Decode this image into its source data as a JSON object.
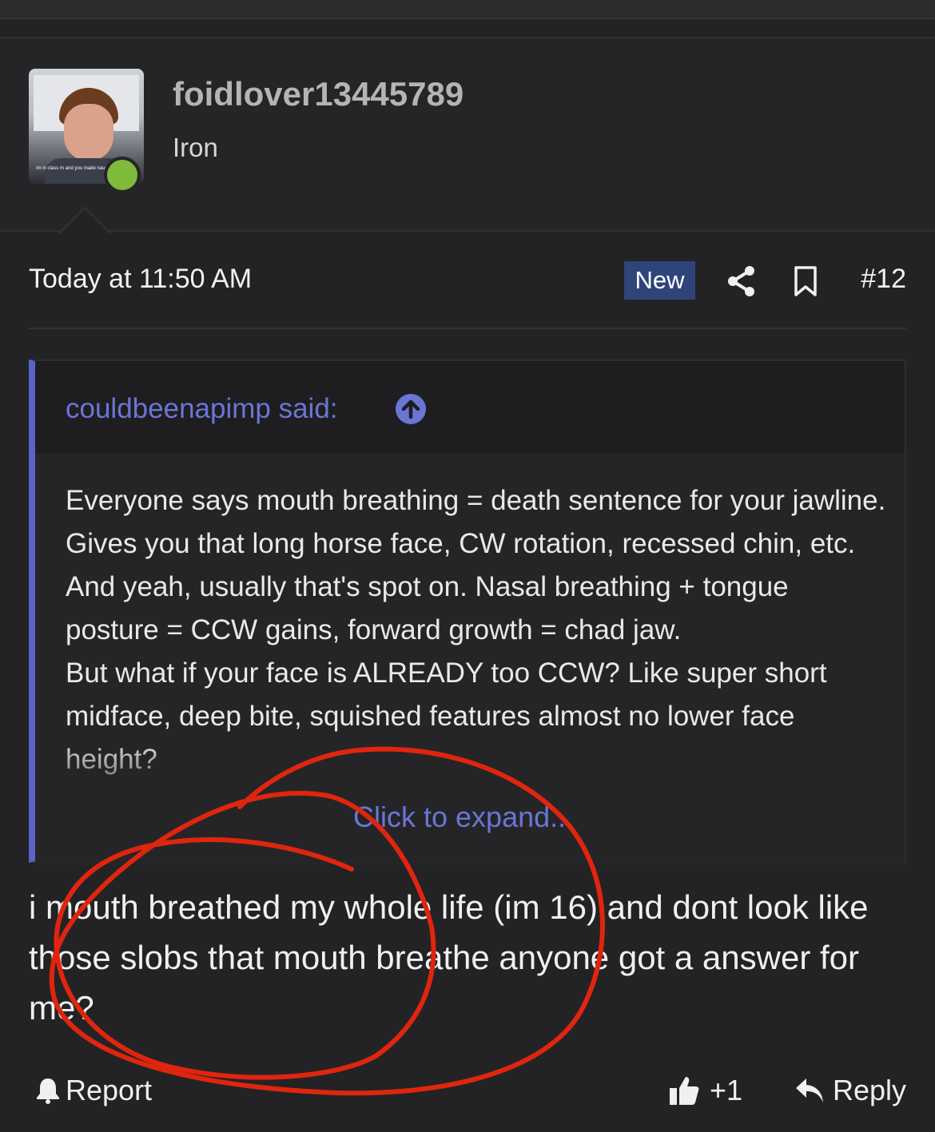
{
  "user": {
    "name": "foidlover13445789",
    "title": "Iron",
    "avatar_caption": "im in class rn and you made naughty whore",
    "online_color": "#7fba3a"
  },
  "post": {
    "date": "Today at 11:50 AM",
    "badge": "New",
    "number": "#12",
    "share_icon": "share-icon",
    "bookmark_icon": "bookmark-icon"
  },
  "quote": {
    "author": "couldbeenapimp said:",
    "paragraphs": [
      "Everyone says mouth breathing = death sentence for your jawline. Gives you that long horse face, CW rotation, recessed chin, etc. And yeah, usually that's spot on. Nasal breathing + tongue posture = CCW gains, forward growth = chad jaw.",
      "But what if your face is ALREADY too CCW? Like super short midface, deep bite, squished features almost no lower face height?"
    ],
    "expand": "Click to expand..."
  },
  "message": "i mouth breathed my whole life (im 16) and dont look like those slobs that mouth breathe anyone got a answer for me?",
  "footer": {
    "report": "Report",
    "likes": "+1",
    "reply": "Reply"
  },
  "colors": {
    "accent": "#6b75d6",
    "badge_bg": "#2f4478",
    "scribble": "#e0250f",
    "background": "#232325"
  }
}
